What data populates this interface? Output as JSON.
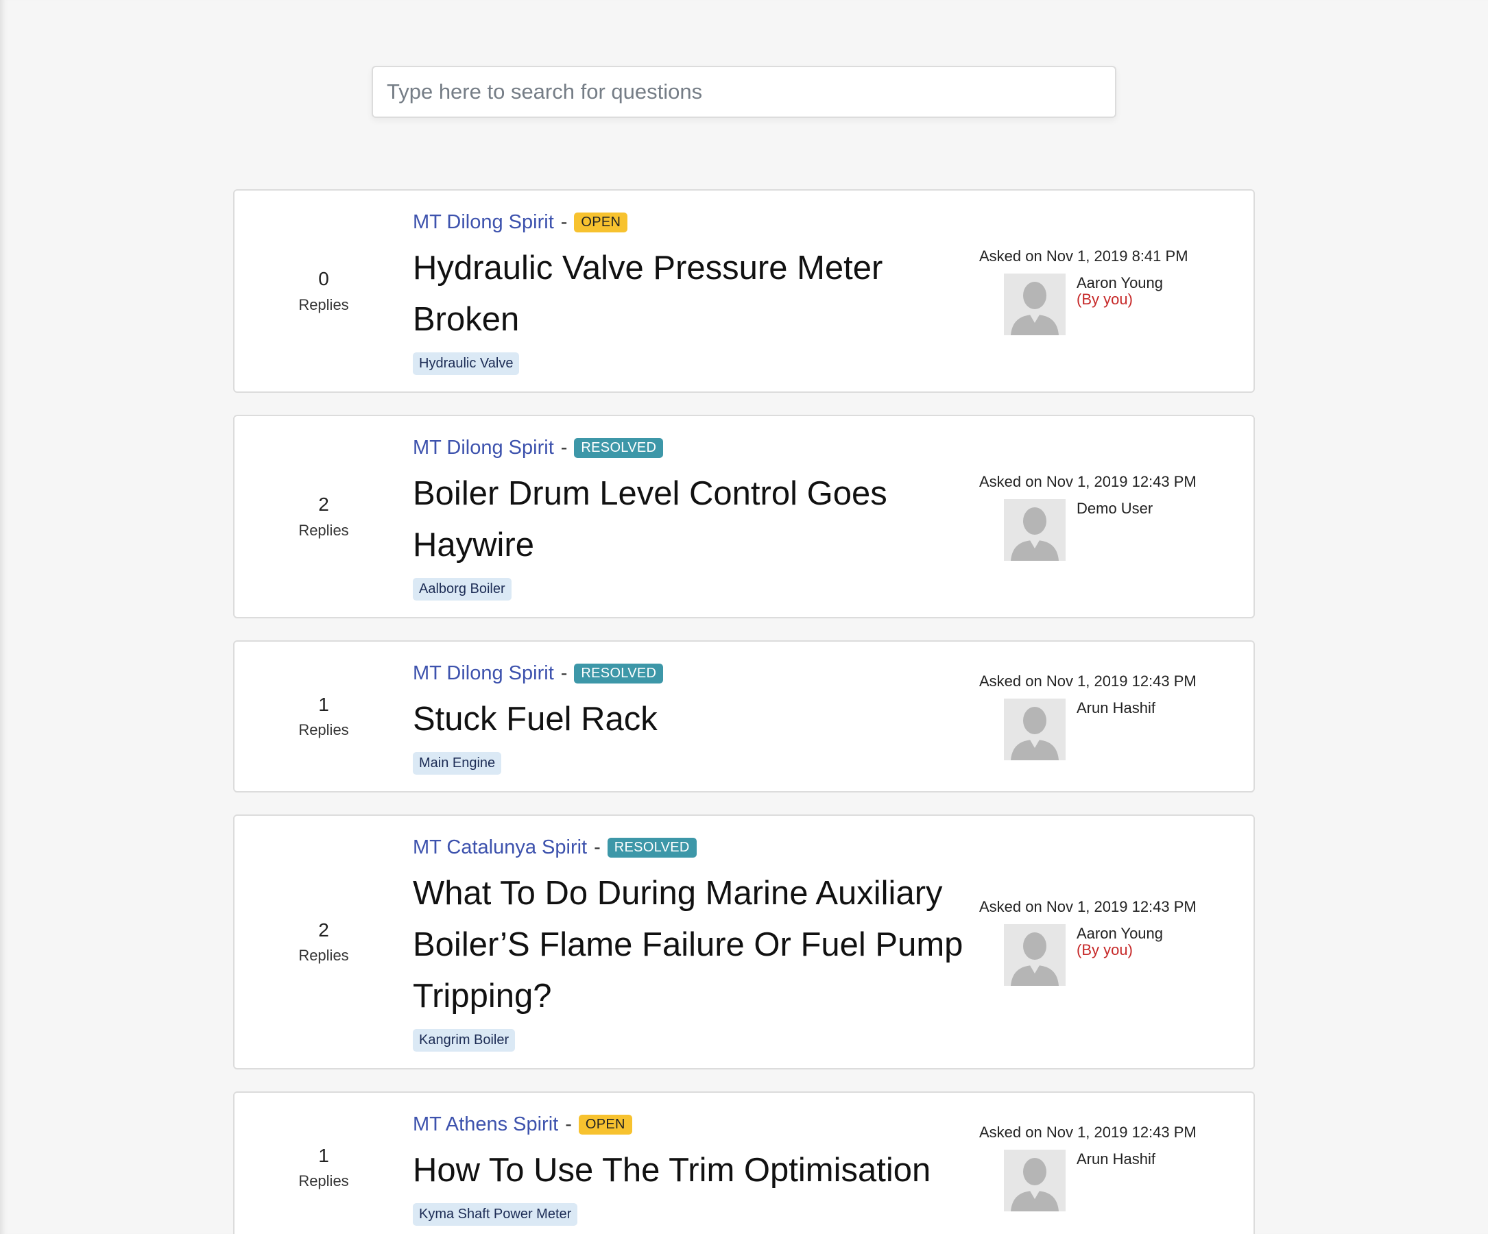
{
  "search": {
    "placeholder": "Type here to search for questions"
  },
  "reply_label": "Replies",
  "asked_prefix": "Asked on",
  "questions": [
    {
      "replies": "0",
      "ship": "MT Dilong Spirit",
      "status": "OPEN",
      "title": "Hydraulic Valve Pressure Meter Broken",
      "tag": "Hydraulic Valve",
      "asked": "Asked on Nov 1, 2019 8:41 PM",
      "user": "Aaron Young",
      "by_you": "(By you)"
    },
    {
      "replies": "2",
      "ship": "MT Dilong Spirit",
      "status": "RESOLVED",
      "title": "Boiler Drum Level Control Goes Haywire",
      "tag": "Aalborg Boiler",
      "asked": "Asked on Nov 1, 2019 12:43 PM",
      "user": "Demo User",
      "by_you": ""
    },
    {
      "replies": "1",
      "ship": "MT Dilong Spirit",
      "status": "RESOLVED",
      "title": "Stuck Fuel Rack",
      "tag": "Main Engine",
      "asked": "Asked on Nov 1, 2019 12:43 PM",
      "user": "Arun Hashif",
      "by_you": ""
    },
    {
      "replies": "2",
      "ship": "MT Catalunya Spirit",
      "status": "RESOLVED",
      "title": "What To Do During Marine Auxiliary Boiler’S Flame Failure Or Fuel Pump Tripping?",
      "tag": "Kangrim Boiler",
      "asked": "Asked on Nov 1, 2019 12:43 PM",
      "user": "Aaron Young",
      "by_you": "(By you)"
    },
    {
      "replies": "1",
      "ship": "MT Athens Spirit",
      "status": "OPEN",
      "title": "How To Use The Trim Optimisation",
      "tag": "Kyma Shaft Power Meter",
      "asked": "Asked on Nov 1, 2019 12:43 PM",
      "user": "Arun Hashif",
      "by_you": ""
    }
  ],
  "colors": {
    "ship_link": "#3d52ad",
    "status_open": "#f7c22f",
    "status_resolved": "#3d97a8",
    "tag_bg": "#dbe9f5",
    "by_you": "#c62828"
  },
  "icons": {
    "avatar": "default-user-avatar-icon"
  }
}
